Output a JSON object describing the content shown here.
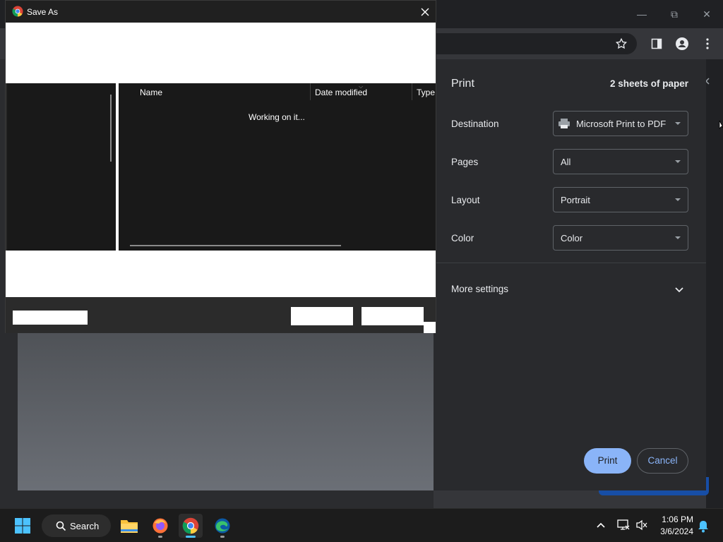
{
  "dialog": {
    "title": "Save As",
    "columns": [
      "Name",
      "Date modified",
      "Type"
    ],
    "status_text": "Working on it..."
  },
  "print_panel": {
    "title": "Print",
    "sheets": "2 sheets of paper",
    "destination": {
      "label": "Destination",
      "value": "Microsoft Print to PDF"
    },
    "pages": {
      "label": "Pages",
      "value": "All"
    },
    "layout": {
      "label": "Layout",
      "value": "Portrait"
    },
    "color": {
      "label": "Color",
      "value": "Color"
    },
    "more_settings": "More settings",
    "print_label": "Print",
    "cancel_label": "Cancel"
  },
  "taskbar": {
    "search_label": "Search",
    "time": "1:06 PM",
    "date": "3/6/2024",
    "apps": [
      "file-explorer-icon",
      "firefox-icon",
      "chrome-icon",
      "edge-icon"
    ]
  },
  "colors": {
    "accent": "#8ab4f8",
    "panel_bg": "#292a2d",
    "dialog_bg": "#191919"
  }
}
